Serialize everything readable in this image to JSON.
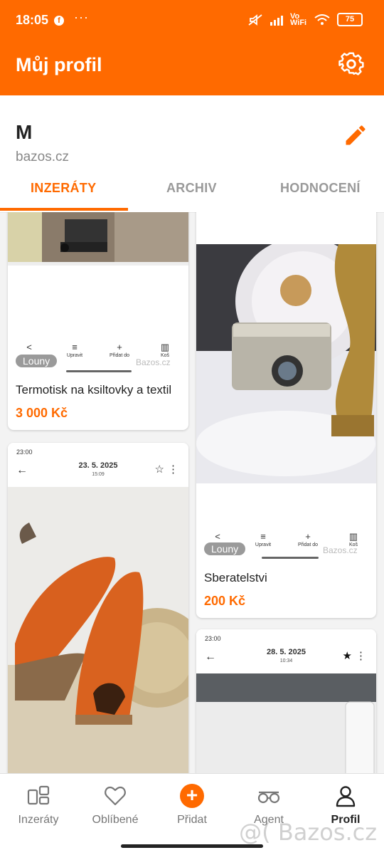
{
  "status": {
    "time": "18:05",
    "fb": "f",
    "more": "···",
    "network": "Vo WiFi",
    "battery": "75"
  },
  "appbar": {
    "title": "Můj profil"
  },
  "profile": {
    "name": "M",
    "site": "bazos.cz"
  },
  "tabs": [
    {
      "label": "INZERÁTY"
    },
    {
      "label": "ARCHIV"
    },
    {
      "label": "HODNOCENÍ"
    }
  ],
  "actions": {
    "share": "",
    "edit": "Upravit",
    "add": "Přidat do",
    "delete": "Koš"
  },
  "listings": [
    {
      "title": "Termotisk na ksiltovky a textil",
      "price": "3 000 Kč",
      "location": "Louny",
      "watermark": "Bazos.cz"
    },
    {
      "title": "Sberatelstvi",
      "price": "200 Kč",
      "location": "Louny",
      "watermark": "Bazos.cz"
    },
    {
      "phone_time": "23:00",
      "date": "23. 5. 2025",
      "time": "15:09"
    },
    {
      "phone_time": "23:00",
      "date": "28. 5. 2025",
      "time": "10:34"
    }
  ],
  "nav": [
    {
      "label": "Inzeráty"
    },
    {
      "label": "Oblíbené"
    },
    {
      "label": "Přidat"
    },
    {
      "label": "Agent"
    },
    {
      "label": "Profil"
    }
  ],
  "footer_watermark": "@( Bazos.cz",
  "colors": {
    "accent": "#ff6a00",
    "price": "#ff6a00"
  }
}
